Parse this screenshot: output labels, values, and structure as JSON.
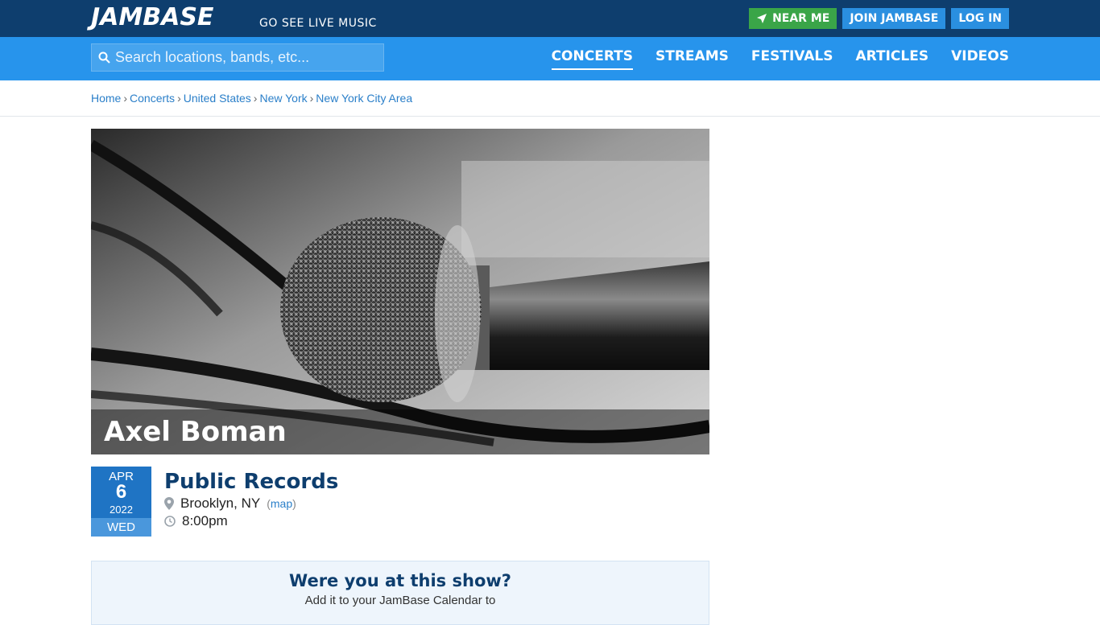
{
  "header": {
    "logo_text": "JAMBASE",
    "tagline": "GO SEE LIVE MUSIC",
    "near_me": "NEAR ME",
    "join": "JOIN JAMBASE",
    "login": "LOG IN"
  },
  "nav": {
    "search_placeholder": "Search locations, bands, etc...",
    "links": [
      "CONCERTS",
      "STREAMS",
      "FESTIVALS",
      "ARTICLES",
      "VIDEOS"
    ],
    "active": "CONCERTS"
  },
  "breadcrumb": [
    "Home",
    "Concerts",
    "United States",
    "New York",
    "New York City Area"
  ],
  "event": {
    "artist": "Axel Boman",
    "venue": "Public Records",
    "location": "Brooklyn, NY",
    "map_label": "map",
    "time": "8:00pm",
    "date": {
      "month": "APR",
      "day": "6",
      "year": "2022",
      "weekday": "WED"
    }
  },
  "attend": {
    "title": "Were you at this show?",
    "subtitle": "Add it to your JamBase Calendar to"
  },
  "colors": {
    "topbar": "#0e3e6e",
    "navbar": "#2794ec",
    "near_me": "#3aa548",
    "accent": "#1f74c4"
  }
}
